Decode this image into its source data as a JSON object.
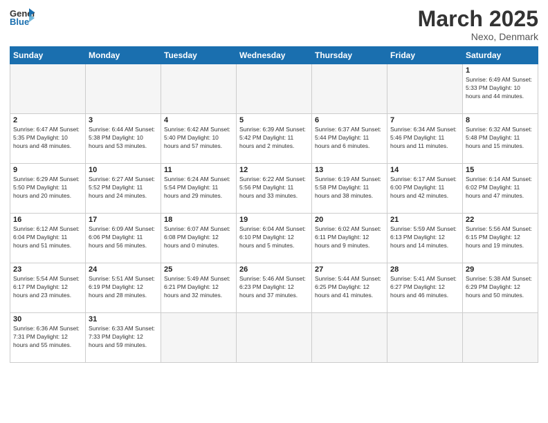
{
  "header": {
    "logo_general": "General",
    "logo_blue": "Blue",
    "month": "March 2025",
    "location": "Nexo, Denmark"
  },
  "weekdays": [
    "Sunday",
    "Monday",
    "Tuesday",
    "Wednesday",
    "Thursday",
    "Friday",
    "Saturday"
  ],
  "weeks": [
    [
      {
        "day": "",
        "info": ""
      },
      {
        "day": "",
        "info": ""
      },
      {
        "day": "",
        "info": ""
      },
      {
        "day": "",
        "info": ""
      },
      {
        "day": "",
        "info": ""
      },
      {
        "day": "",
        "info": ""
      },
      {
        "day": "1",
        "info": "Sunrise: 6:49 AM\nSunset: 5:33 PM\nDaylight: 10 hours\nand 44 minutes."
      }
    ],
    [
      {
        "day": "2",
        "info": "Sunrise: 6:47 AM\nSunset: 5:35 PM\nDaylight: 10 hours\nand 48 minutes."
      },
      {
        "day": "3",
        "info": "Sunrise: 6:44 AM\nSunset: 5:38 PM\nDaylight: 10 hours\nand 53 minutes."
      },
      {
        "day": "4",
        "info": "Sunrise: 6:42 AM\nSunset: 5:40 PM\nDaylight: 10 hours\nand 57 minutes."
      },
      {
        "day": "5",
        "info": "Sunrise: 6:39 AM\nSunset: 5:42 PM\nDaylight: 11 hours\nand 2 minutes."
      },
      {
        "day": "6",
        "info": "Sunrise: 6:37 AM\nSunset: 5:44 PM\nDaylight: 11 hours\nand 6 minutes."
      },
      {
        "day": "7",
        "info": "Sunrise: 6:34 AM\nSunset: 5:46 PM\nDaylight: 11 hours\nand 11 minutes."
      },
      {
        "day": "8",
        "info": "Sunrise: 6:32 AM\nSunset: 5:48 PM\nDaylight: 11 hours\nand 15 minutes."
      }
    ],
    [
      {
        "day": "9",
        "info": "Sunrise: 6:29 AM\nSunset: 5:50 PM\nDaylight: 11 hours\nand 20 minutes."
      },
      {
        "day": "10",
        "info": "Sunrise: 6:27 AM\nSunset: 5:52 PM\nDaylight: 11 hours\nand 24 minutes."
      },
      {
        "day": "11",
        "info": "Sunrise: 6:24 AM\nSunset: 5:54 PM\nDaylight: 11 hours\nand 29 minutes."
      },
      {
        "day": "12",
        "info": "Sunrise: 6:22 AM\nSunset: 5:56 PM\nDaylight: 11 hours\nand 33 minutes."
      },
      {
        "day": "13",
        "info": "Sunrise: 6:19 AM\nSunset: 5:58 PM\nDaylight: 11 hours\nand 38 minutes."
      },
      {
        "day": "14",
        "info": "Sunrise: 6:17 AM\nSunset: 6:00 PM\nDaylight: 11 hours\nand 42 minutes."
      },
      {
        "day": "15",
        "info": "Sunrise: 6:14 AM\nSunset: 6:02 PM\nDaylight: 11 hours\nand 47 minutes."
      }
    ],
    [
      {
        "day": "16",
        "info": "Sunrise: 6:12 AM\nSunset: 6:04 PM\nDaylight: 11 hours\nand 51 minutes."
      },
      {
        "day": "17",
        "info": "Sunrise: 6:09 AM\nSunset: 6:06 PM\nDaylight: 11 hours\nand 56 minutes."
      },
      {
        "day": "18",
        "info": "Sunrise: 6:07 AM\nSunset: 6:08 PM\nDaylight: 12 hours\nand 0 minutes."
      },
      {
        "day": "19",
        "info": "Sunrise: 6:04 AM\nSunset: 6:10 PM\nDaylight: 12 hours\nand 5 minutes."
      },
      {
        "day": "20",
        "info": "Sunrise: 6:02 AM\nSunset: 6:11 PM\nDaylight: 12 hours\nand 9 minutes."
      },
      {
        "day": "21",
        "info": "Sunrise: 5:59 AM\nSunset: 6:13 PM\nDaylight: 12 hours\nand 14 minutes."
      },
      {
        "day": "22",
        "info": "Sunrise: 5:56 AM\nSunset: 6:15 PM\nDaylight: 12 hours\nand 19 minutes."
      }
    ],
    [
      {
        "day": "23",
        "info": "Sunrise: 5:54 AM\nSunset: 6:17 PM\nDaylight: 12 hours\nand 23 minutes."
      },
      {
        "day": "24",
        "info": "Sunrise: 5:51 AM\nSunset: 6:19 PM\nDaylight: 12 hours\nand 28 minutes."
      },
      {
        "day": "25",
        "info": "Sunrise: 5:49 AM\nSunset: 6:21 PM\nDaylight: 12 hours\nand 32 minutes."
      },
      {
        "day": "26",
        "info": "Sunrise: 5:46 AM\nSunset: 6:23 PM\nDaylight: 12 hours\nand 37 minutes."
      },
      {
        "day": "27",
        "info": "Sunrise: 5:44 AM\nSunset: 6:25 PM\nDaylight: 12 hours\nand 41 minutes."
      },
      {
        "day": "28",
        "info": "Sunrise: 5:41 AM\nSunset: 6:27 PM\nDaylight: 12 hours\nand 46 minutes."
      },
      {
        "day": "29",
        "info": "Sunrise: 5:38 AM\nSunset: 6:29 PM\nDaylight: 12 hours\nand 50 minutes."
      }
    ],
    [
      {
        "day": "30",
        "info": "Sunrise: 6:36 AM\nSunset: 7:31 PM\nDaylight: 12 hours\nand 55 minutes."
      },
      {
        "day": "31",
        "info": "Sunrise: 6:33 AM\nSunset: 7:33 PM\nDaylight: 12 hours\nand 59 minutes."
      },
      {
        "day": "",
        "info": ""
      },
      {
        "day": "",
        "info": ""
      },
      {
        "day": "",
        "info": ""
      },
      {
        "day": "",
        "info": ""
      },
      {
        "day": "",
        "info": ""
      }
    ]
  ]
}
